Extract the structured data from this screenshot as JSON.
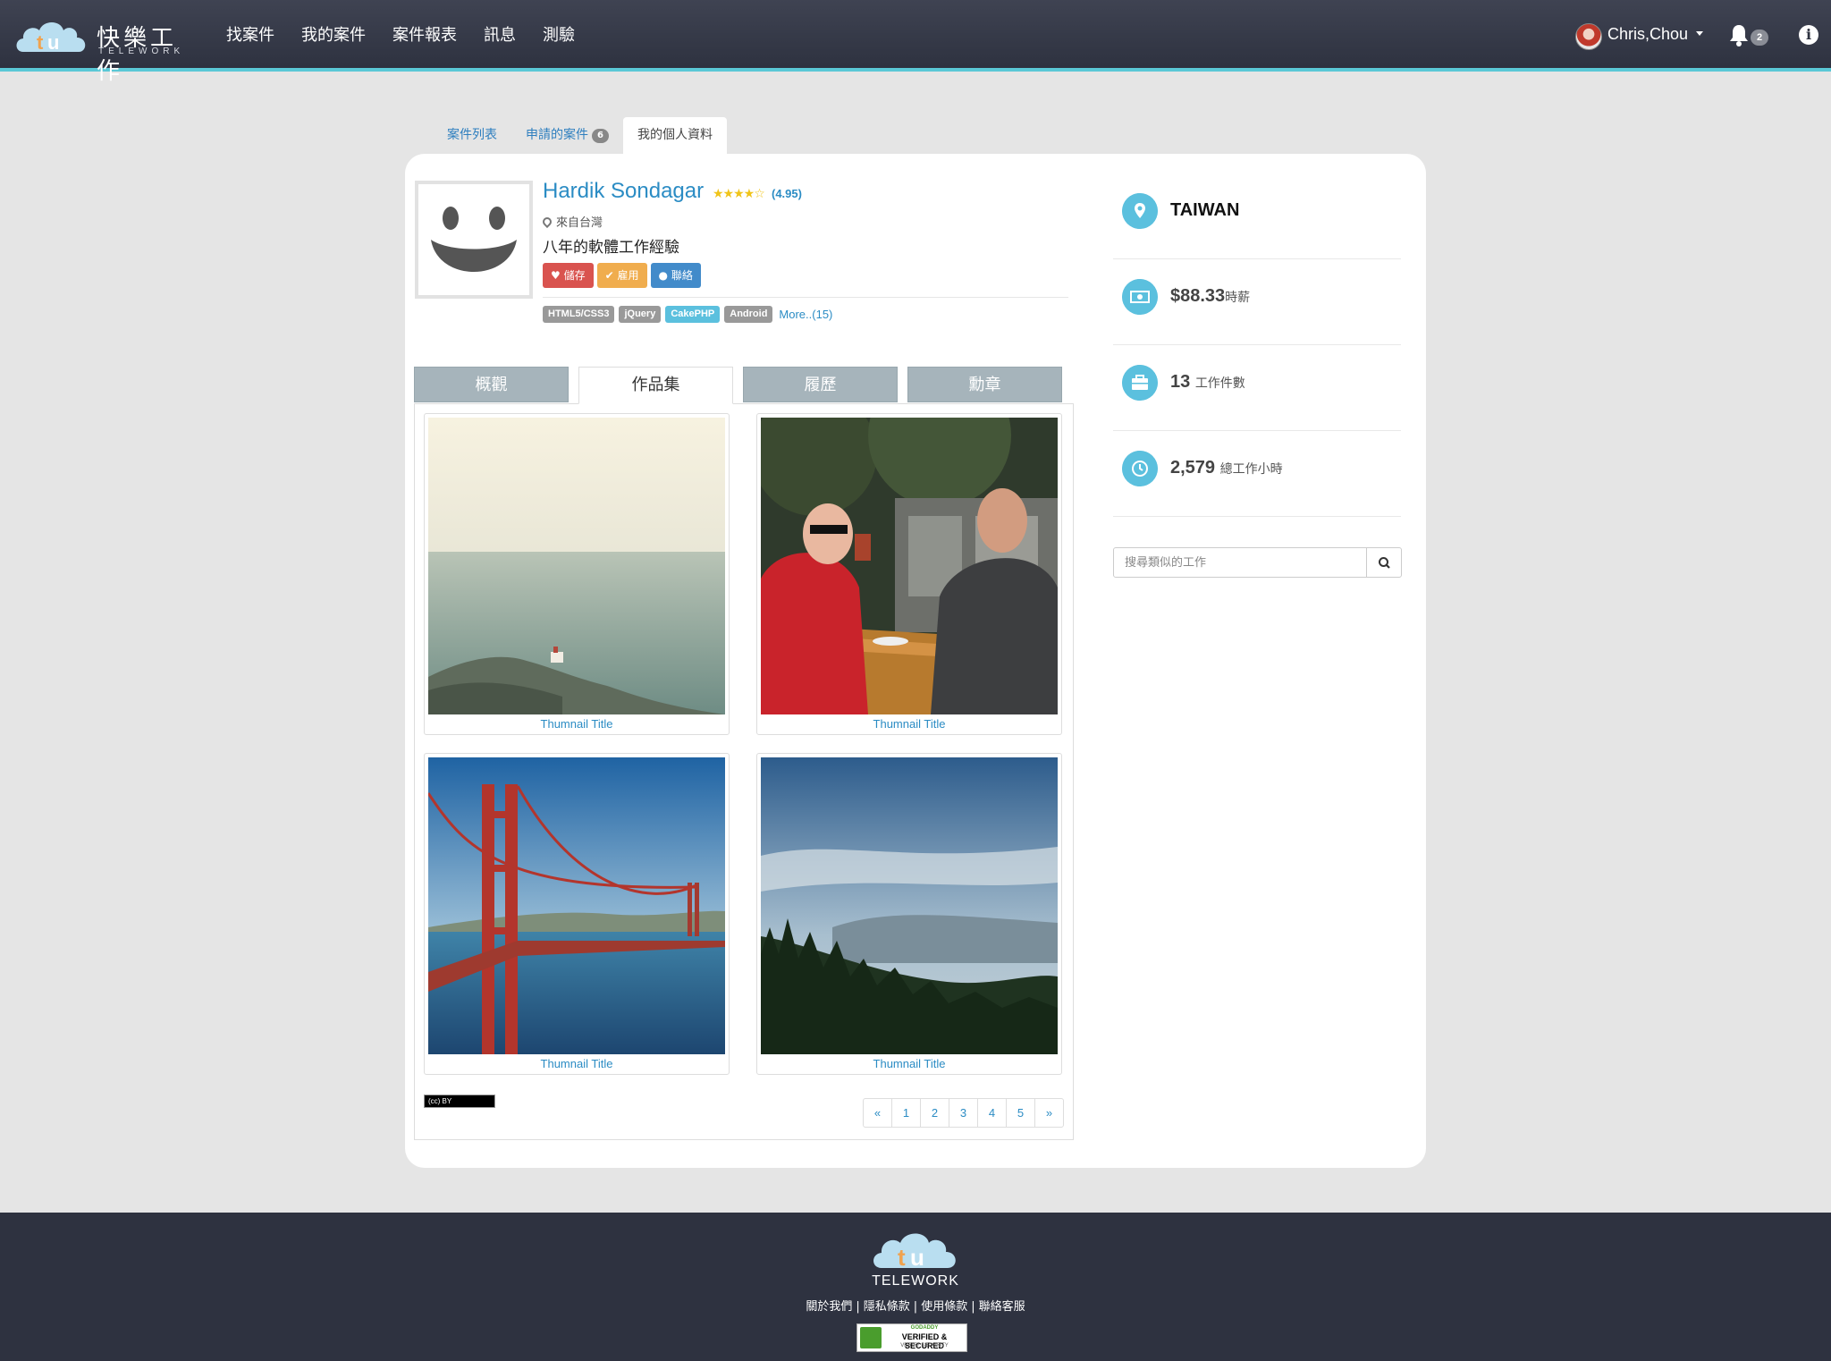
{
  "brand": {
    "zh": "快樂工作",
    "en": "TELEWORK",
    "icon": "tw-cloud-logo"
  },
  "nav": {
    "links": [
      {
        "label": "找案件"
      },
      {
        "label": "我的案件"
      },
      {
        "label": "案件報表"
      },
      {
        "label": "訊息"
      },
      {
        "label": "測驗"
      }
    ],
    "user_name": "Chris,Chou",
    "notification_count": "2",
    "info_icon": "i"
  },
  "top_tabs": [
    {
      "label": "案件列表",
      "badge": ""
    },
    {
      "label": "申請的案件",
      "badge": "6"
    },
    {
      "label": "我的個人資料",
      "badge": "",
      "active": true
    }
  ],
  "profile": {
    "name": "Hardik Sondagar",
    "stars": "★★★★☆",
    "rating": 4.95,
    "rating_text": "(4.95)",
    "location": "來自台灣",
    "experience": "八年的軟體工作經驗",
    "actions": {
      "save": "儲存",
      "hire": "雇用",
      "contact": "聯絡"
    },
    "skills": [
      {
        "label": "HTML5/CSS3",
        "highlight": false
      },
      {
        "label": "jQuery",
        "highlight": false
      },
      {
        "label": "CakePHP",
        "highlight": true
      },
      {
        "label": "Android",
        "highlight": false
      }
    ],
    "more_link": "More..(15)"
  },
  "content_tabs": [
    {
      "label": "概觀"
    },
    {
      "label": "作品集",
      "active": true
    },
    {
      "label": "履歷"
    },
    {
      "label": "勳章"
    }
  ],
  "portfolio": {
    "items": [
      {
        "caption": "Thumnail Title",
        "image": "coastal-lighthouse-photo"
      },
      {
        "caption": "Thumnail Title",
        "image": "cafe-cyclists-photo"
      },
      {
        "caption": "Thumnail Title",
        "image": "golden-gate-bridge-photo"
      },
      {
        "caption": "Thumnail Title",
        "image": "forest-valley-photo"
      }
    ],
    "license_badge": "(cc) BY",
    "pagination": [
      "«",
      "1",
      "2",
      "3",
      "4",
      "5",
      "»"
    ]
  },
  "sidebar": {
    "country": "TAIWAN",
    "hourly_rate": "$88.33",
    "hourly_rate_label": "時薪",
    "jobs_count": "13",
    "jobs_label": "工作件數",
    "total_hours": "2,579",
    "total_hours_label": "總工作小時",
    "search_placeholder": "搜尋類似的工作"
  },
  "footer": {
    "brand": "TELEWORK",
    "links": [
      "關於我們",
      "隱私條款",
      "使用條款",
      "聯絡客服"
    ],
    "separator": "|",
    "seal": {
      "line1": "GODADDY",
      "line2": "VERIFIED & SECURED",
      "line3": "VERIFY SECURITY"
    }
  },
  "colors": {
    "navbar": "#2e3240",
    "accent": "#5ac8d6",
    "link": "#2b8cc4",
    "stat_icon": "#5bc0de",
    "save": "#d9534f",
    "hire": "#f0ad4e",
    "contact": "#428bca"
  }
}
